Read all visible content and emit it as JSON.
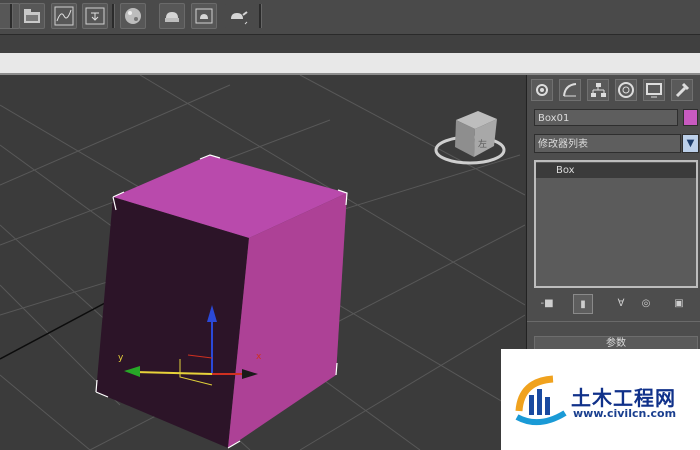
{
  "toolbar": {
    "buttons": [
      "open-file-icon",
      "curve-editor-icon",
      "schematic-icon",
      "material-editor-icon",
      "render-setup-icon",
      "render-frame-icon",
      "render-teapot-icon"
    ]
  },
  "viewport": {
    "object_color": "#c04fb3",
    "axis_labels": {
      "y": "y",
      "x": "x"
    },
    "viewcube_face_label": "左"
  },
  "command_panel": {
    "object_name": "Box01",
    "object_color": "#c85ac0",
    "modifier_list": "修改器列表",
    "stack": [
      {
        "label": "Box"
      }
    ],
    "rollout_title": "参数"
  },
  "watermark": {
    "title": "土木工程网",
    "url": "www.civilcn.com"
  }
}
